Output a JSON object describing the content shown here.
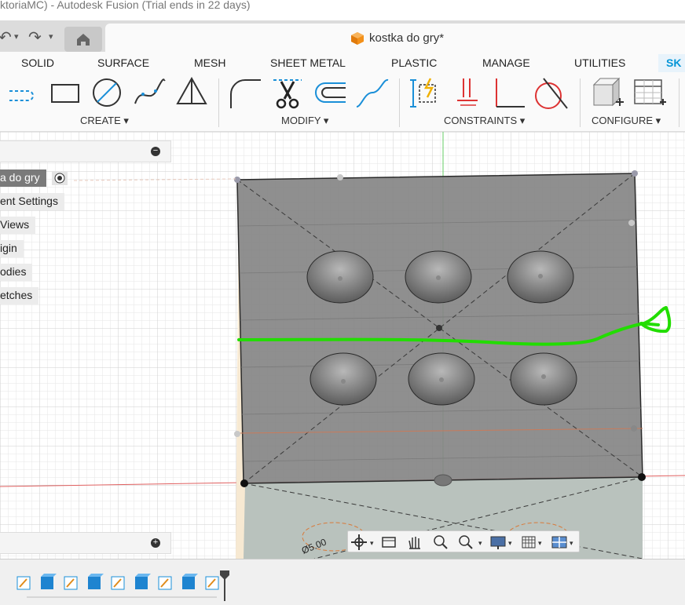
{
  "window": {
    "title": "ktoriaMC) - Autodesk Fusion (Trial ends in 22 days)"
  },
  "document": {
    "tab_title": "kostka do gry*"
  },
  "ribbon_tabs": [
    "SOLID",
    "SURFACE",
    "MESH",
    "SHEET METAL",
    "PLASTIC",
    "MANAGE",
    "UTILITIES",
    "SK"
  ],
  "ribbon_groups": {
    "create": "CREATE ▾",
    "modify": "MODIFY ▾",
    "constraints": "CONSTRAINTS ▾",
    "configure": "CONFIGURE ▾"
  },
  "browser": {
    "items": [
      "a do gry",
      "ent Settings",
      "Views",
      "igin",
      "odies",
      "etches"
    ]
  },
  "viewport": {
    "dimension_label": "Ø5.00"
  },
  "colors": {
    "accent": "#0696d7",
    "sketch_stroke": "#22dd00",
    "face": "#8a8a8a"
  }
}
